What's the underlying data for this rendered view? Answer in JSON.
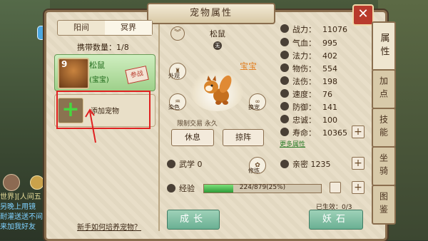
{
  "window": {
    "title": "宠物属性",
    "close_label": "✕"
  },
  "side_tabs": [
    {
      "label": "属性",
      "active": true
    },
    {
      "label": "加点",
      "active": false
    },
    {
      "label": "技能",
      "active": false
    },
    {
      "label": "坐骑",
      "active": false
    },
    {
      "label": "图鉴",
      "active": false
    }
  ],
  "left": {
    "tabs": [
      "阳间",
      "冥界"
    ],
    "active_tab": "冥界",
    "carry_label": "携带数量：",
    "carry_value": "1/8",
    "pet": {
      "level": "9",
      "name": "松鼠",
      "sub": "(宝宝)",
      "status": "参战"
    },
    "add_label": "添加宠物",
    "help_link": "新手如何培养宠物？"
  },
  "center": {
    "pet_name": "松鼠",
    "gender": "无",
    "baobao": "宝宝",
    "ring_buttons": [
      "外观",
      "染色",
      "换宠",
      "改名"
    ],
    "limit_text": "限制交易 永久",
    "rest_label": "休息",
    "formation_label": "掠阵",
    "wuxue_label": "武学",
    "wuxue_value": "0",
    "exp_label": "经验",
    "exp_text": "224/879(25%)",
    "exp_ratio": 0.25,
    "grow_label": "成长",
    "yao_label": "修炼"
  },
  "stats": [
    {
      "label": "战力：",
      "value": "11076"
    },
    {
      "label": "气血：",
      "value": "995"
    },
    {
      "label": "法力：",
      "value": "402"
    },
    {
      "label": "物伤：",
      "value": "554"
    },
    {
      "label": "法伤：",
      "value": "198"
    },
    {
      "label": "速度：",
      "value": "76"
    },
    {
      "label": "防御：",
      "value": "141"
    },
    {
      "label": "忠诚：",
      "value": "100"
    },
    {
      "label": "寿命：",
      "value": "10365"
    }
  ],
  "more_attrs": "更多属性",
  "intimacy": {
    "label": "亲密",
    "value": "1235"
  },
  "effective": "已生效：0/3",
  "stone_label": "妖石",
  "chat": {
    "lines": [
      "世界][人间五",
      "另晚上用镜",
      "耐灌送送不间",
      "来加我好友"
    ]
  }
}
